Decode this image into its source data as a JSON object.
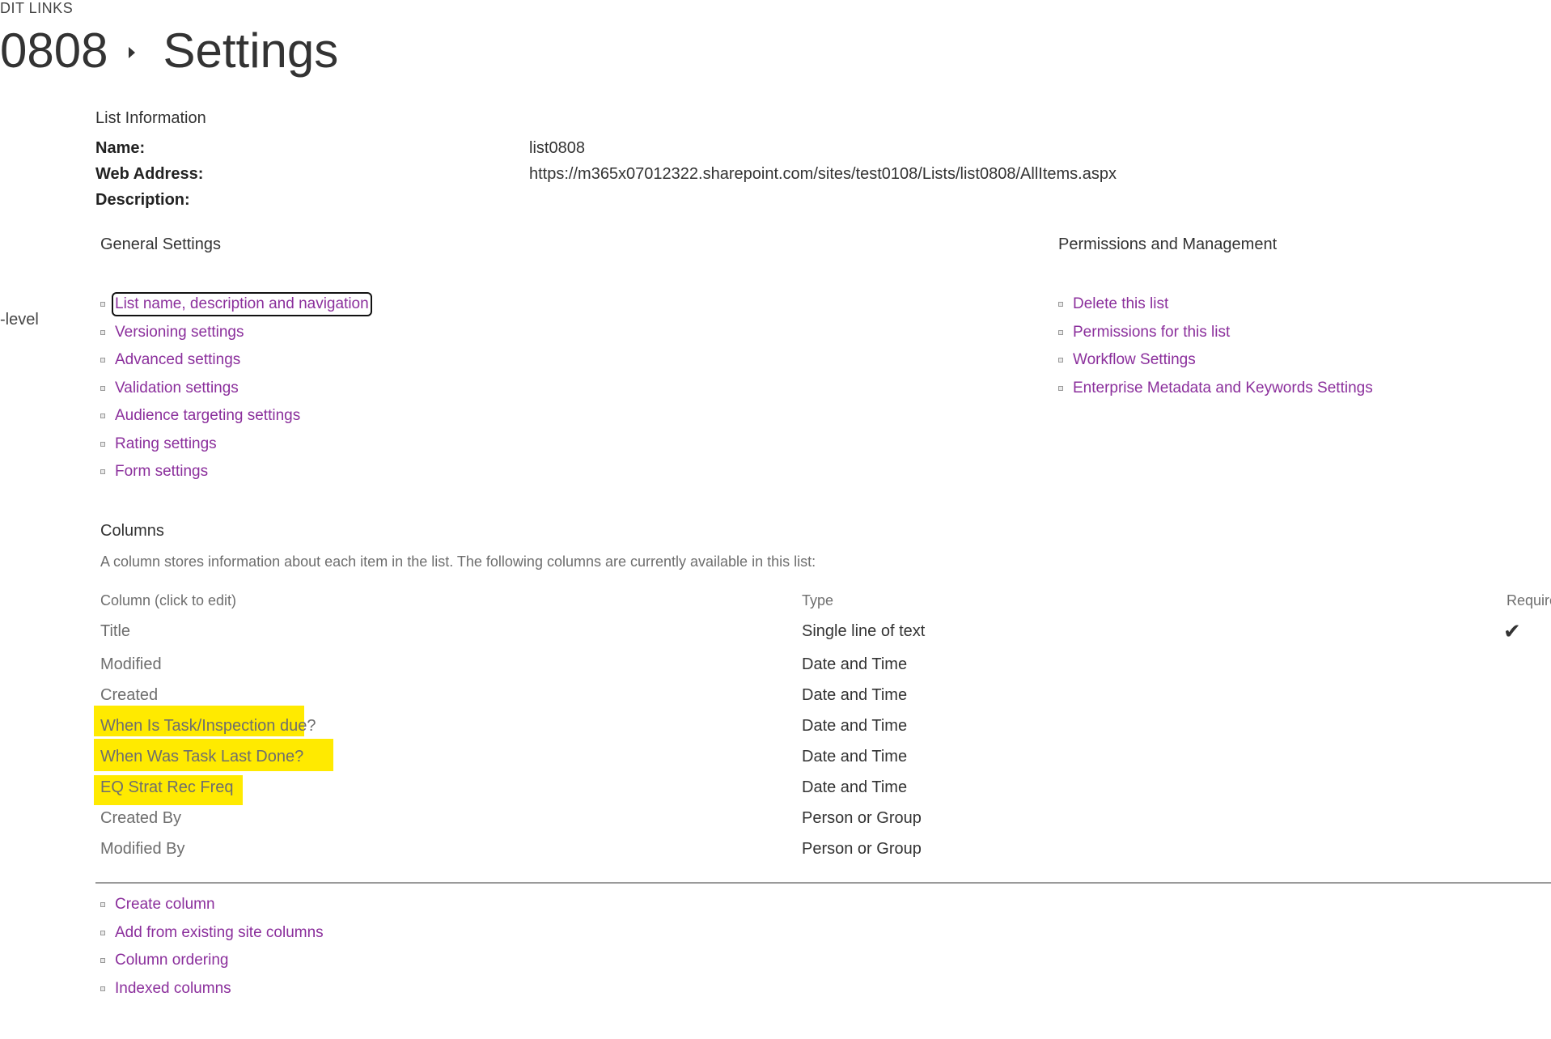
{
  "header": {
    "edit_links": "DIT LINKS",
    "breadcrumb_list": "0808",
    "page_title": "Settings"
  },
  "left_nav": {
    "partial_text": "-level"
  },
  "list_information": {
    "heading": "List Information",
    "name_label": "Name:",
    "name_value": "list0808",
    "web_address_label": "Web Address:",
    "web_address_value": "https://m365x07012322.sharepoint.com/sites/test0108/Lists/list0808/AllItems.aspx",
    "description_label": "Description:"
  },
  "general_settings": {
    "heading": "General Settings",
    "links": [
      "List name, description and navigation",
      "Versioning settings",
      "Advanced settings",
      "Validation settings",
      "Audience targeting settings",
      "Rating settings",
      "Form settings"
    ]
  },
  "permissions": {
    "heading": "Permissions and Management",
    "links": [
      "Delete this list",
      "Permissions for this list",
      "Workflow Settings",
      "Enterprise Metadata and Keywords Settings"
    ]
  },
  "columns": {
    "heading": "Columns",
    "description": "A column stores information about each item in the list. The following columns are currently available in this list:",
    "headers": {
      "name": "Column (click to edit)",
      "type": "Type",
      "required": "Require"
    },
    "rows": [
      {
        "name": "Title",
        "type": "Single line of text",
        "required": true,
        "highlighted": false
      },
      {
        "name": "Modified",
        "type": "Date and Time",
        "required": false,
        "highlighted": false
      },
      {
        "name": "Created",
        "type": "Date and Time",
        "required": false,
        "highlighted": false
      },
      {
        "name": "When Is Task/Inspection due?",
        "type": "Date and Time",
        "required": false,
        "highlighted": true
      },
      {
        "name": "When Was Task Last Done?",
        "type": "Date and Time",
        "required": false,
        "highlighted": true
      },
      {
        "name": "EQ Strat Rec Freq",
        "type": "Date and Time",
        "required": false,
        "highlighted": true
      },
      {
        "name": "Created By",
        "type": "Person or Group",
        "required": false,
        "highlighted": false
      },
      {
        "name": "Modified By",
        "type": "Person or Group",
        "required": false,
        "highlighted": false
      }
    ],
    "checkmark": "✔",
    "footer_links": [
      "Create column",
      "Add from existing site columns",
      "Column ordering",
      "Indexed columns"
    ]
  },
  "colors": {
    "link": "#8b2f9c",
    "highlight": "#ffea00",
    "text": "#444444",
    "muted": "#6e6e6e"
  }
}
